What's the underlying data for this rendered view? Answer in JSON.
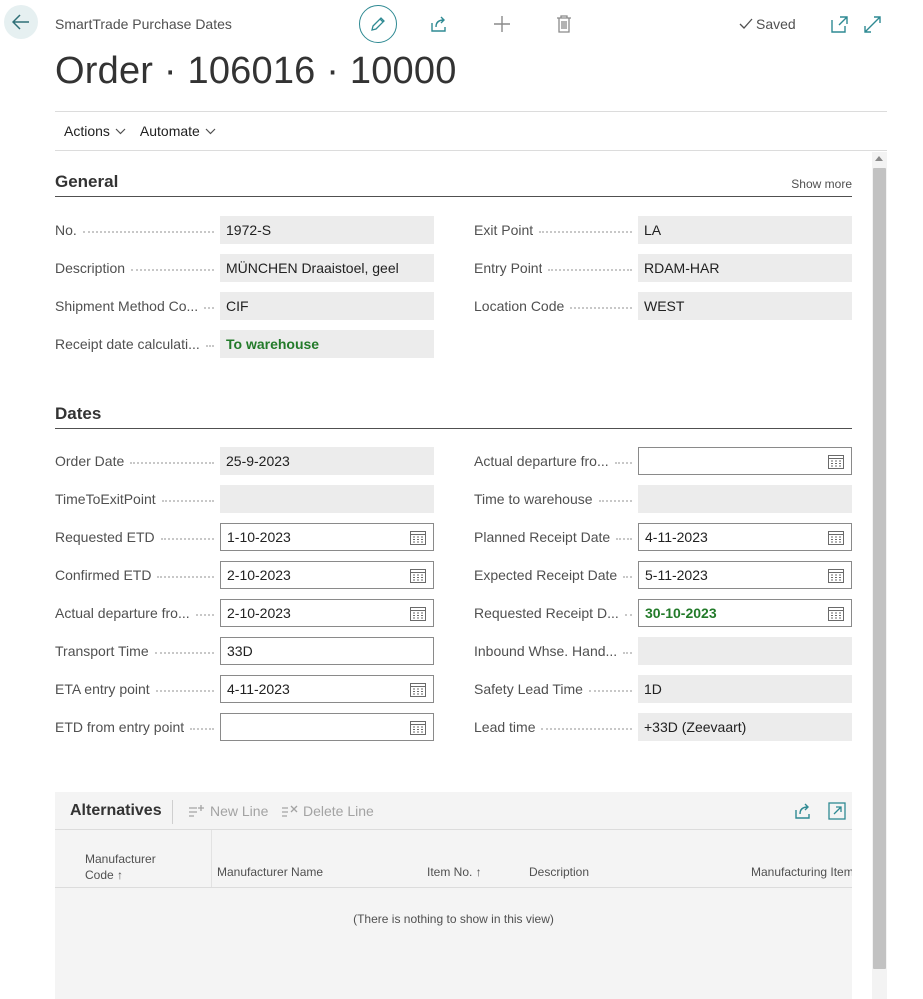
{
  "header": {
    "caption": "SmartTrade Purchase Dates",
    "title": "Order · 106016 · 10000",
    "saved_label": "Saved"
  },
  "menu": {
    "items": [
      {
        "label": "Actions"
      },
      {
        "label": "Automate"
      }
    ]
  },
  "general": {
    "title": "General",
    "show_more": "Show more",
    "left": [
      {
        "label": "No.",
        "value": "1972-S"
      },
      {
        "label": "Description",
        "value": "MÜNCHEN Draaistoel, geel"
      },
      {
        "label": "Shipment Method Co...",
        "value": "CIF"
      },
      {
        "label": "Receipt date calculati...",
        "value": "To warehouse"
      }
    ],
    "right": [
      {
        "label": "Exit Point",
        "value": "LA"
      },
      {
        "label": "Entry Point",
        "value": "RDAM-HAR"
      },
      {
        "label": "Location Code",
        "value": "WEST"
      }
    ]
  },
  "dates": {
    "title": "Dates",
    "left": [
      {
        "label": "Order Date",
        "value": "25-9-2023"
      },
      {
        "label": "TimeToExitPoint",
        "value": ""
      },
      {
        "label": "Requested ETD",
        "value": "1-10-2023"
      },
      {
        "label": "Confirmed ETD",
        "value": "2-10-2023"
      },
      {
        "label": "Actual departure fro...",
        "value": "2-10-2023"
      },
      {
        "label": "Transport Time",
        "value": "33D"
      },
      {
        "label": "ETA entry point",
        "value": "4-11-2023"
      },
      {
        "label": "ETD from entry point",
        "value": ""
      }
    ],
    "right": [
      {
        "label": "Actual departure fro...",
        "value": ""
      },
      {
        "label": "Time to warehouse",
        "value": ""
      },
      {
        "label": "Planned Receipt Date",
        "value": "4-11-2023"
      },
      {
        "label": "Expected Receipt Date",
        "value": "5-11-2023"
      },
      {
        "label": "Requested Receipt D...",
        "value": "30-10-2023"
      },
      {
        "label": "Inbound Whse. Hand...",
        "value": ""
      },
      {
        "label": "Safety Lead Time",
        "value": "1D"
      },
      {
        "label": "Lead time",
        "value": "+33D (Zeevaart)"
      }
    ]
  },
  "alternatives": {
    "title": "Alternatives",
    "new_line": "New Line",
    "delete_line": "Delete Line",
    "columns": {
      "manufacturer_code_1": "Manufacturer",
      "manufacturer_code_2": "Code ↑",
      "manufacturer_name": "Manufacturer Name",
      "item_no": "Item No. ↑",
      "description": "Description",
      "manufacturing_item": "Manufacturing Item"
    },
    "empty_text": "(There is nothing to show in this view)"
  },
  "colors": {
    "accent": "#2f8a93",
    "green_value": "#237b2a",
    "readonly_bg": "#ececec"
  }
}
